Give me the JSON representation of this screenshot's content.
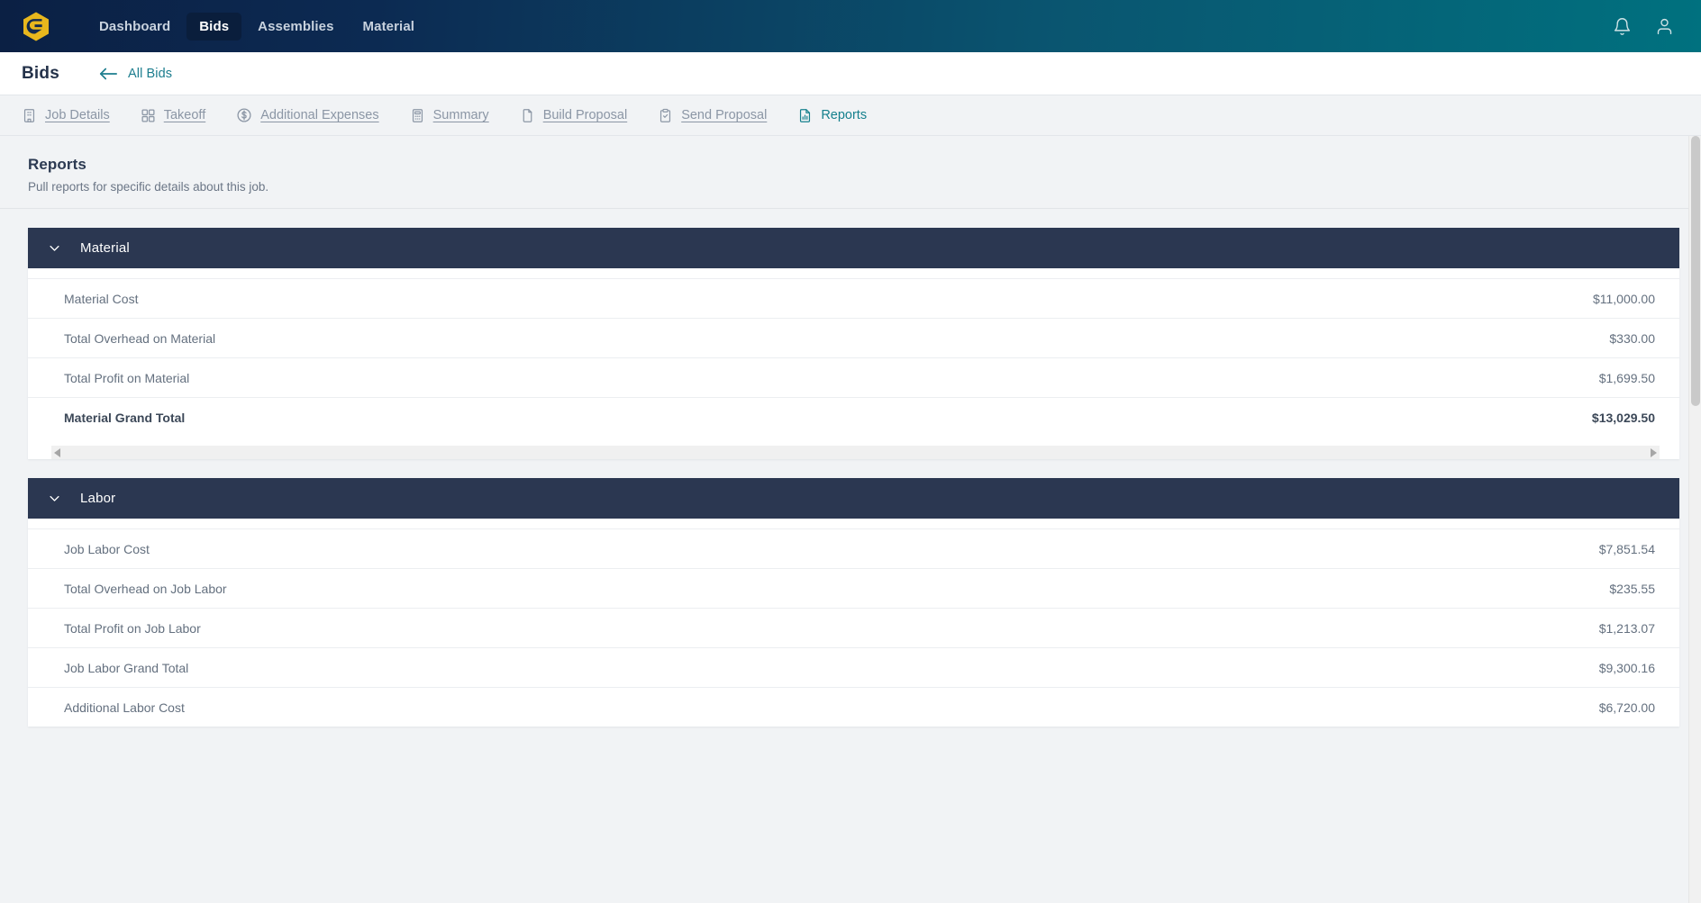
{
  "navbar": {
    "logo_alt": "company-logo",
    "links": [
      {
        "label": "Dashboard",
        "active": false
      },
      {
        "label": "Bids",
        "active": true
      },
      {
        "label": "Assemblies",
        "active": false
      },
      {
        "label": "Material",
        "active": false
      }
    ],
    "icons": [
      {
        "name": "notification-bell-icon"
      },
      {
        "name": "user-account-icon"
      }
    ],
    "gradient_start": "#0b2044",
    "gradient_end": "#00717f",
    "active_pill_color": "#0a1e3c",
    "logo_color": "#e8b71d"
  },
  "subheader": {
    "title": "Bids",
    "back_label": "All Bids",
    "back_icon": "arrow-left-icon",
    "link_color": "#1c7d8e"
  },
  "tabs": [
    {
      "label": "Job Details",
      "icon": "building-icon",
      "active": false
    },
    {
      "label": "Takeoff",
      "icon": "grid-squares-icon",
      "active": false
    },
    {
      "label": "Additional Expenses",
      "icon": "dollar-circle-icon",
      "active": false
    },
    {
      "label": "Summary",
      "icon": "calculator-icon",
      "active": false
    },
    {
      "label": "Build Proposal",
      "icon": "document-icon",
      "active": false
    },
    {
      "label": "Send Proposal",
      "icon": "clipboard-check-icon",
      "active": false
    },
    {
      "label": "Reports",
      "icon": "report-chart-icon",
      "active": true
    }
  ],
  "page": {
    "title": "Reports",
    "subtitle": "Pull reports for specific details about this job."
  },
  "sections": [
    {
      "title": "Material",
      "chevron_icon": "chevron-down-icon",
      "expanded": true,
      "has_scrollbar": true,
      "rows": [
        {
          "label": "Material Cost",
          "value": "$11,000.00",
          "bold": false
        },
        {
          "label": "Total Overhead on Material",
          "value": "$330.00",
          "bold": false
        },
        {
          "label": "Total Profit on Material",
          "value": "$1,699.50",
          "bold": false
        },
        {
          "label": "Material Grand Total",
          "value": "$13,029.50",
          "bold": true
        }
      ]
    },
    {
      "title": "Labor",
      "chevron_icon": "chevron-down-icon",
      "expanded": true,
      "has_scrollbar": false,
      "rows": [
        {
          "label": "Job Labor Cost",
          "value": "$7,851.54",
          "bold": false
        },
        {
          "label": "Total Overhead on Job Labor",
          "value": "$235.55",
          "bold": false
        },
        {
          "label": "Total Profit on Job Labor",
          "value": "$1,213.07",
          "bold": false
        },
        {
          "label": "Job Labor Grand Total",
          "value": "$9,300.16",
          "bold": false
        },
        {
          "label": "Additional Labor Cost",
          "value": "$6,720.00",
          "bold": false
        }
      ]
    }
  ],
  "scrollbar": {
    "left_arrow": "scroll-left-arrow-icon",
    "right_arrow": "scroll-right-arrow-icon"
  },
  "theme": {
    "header_bg": "#2b3751",
    "page_bg": "#f1f3f5",
    "accent": "#15808d"
  }
}
